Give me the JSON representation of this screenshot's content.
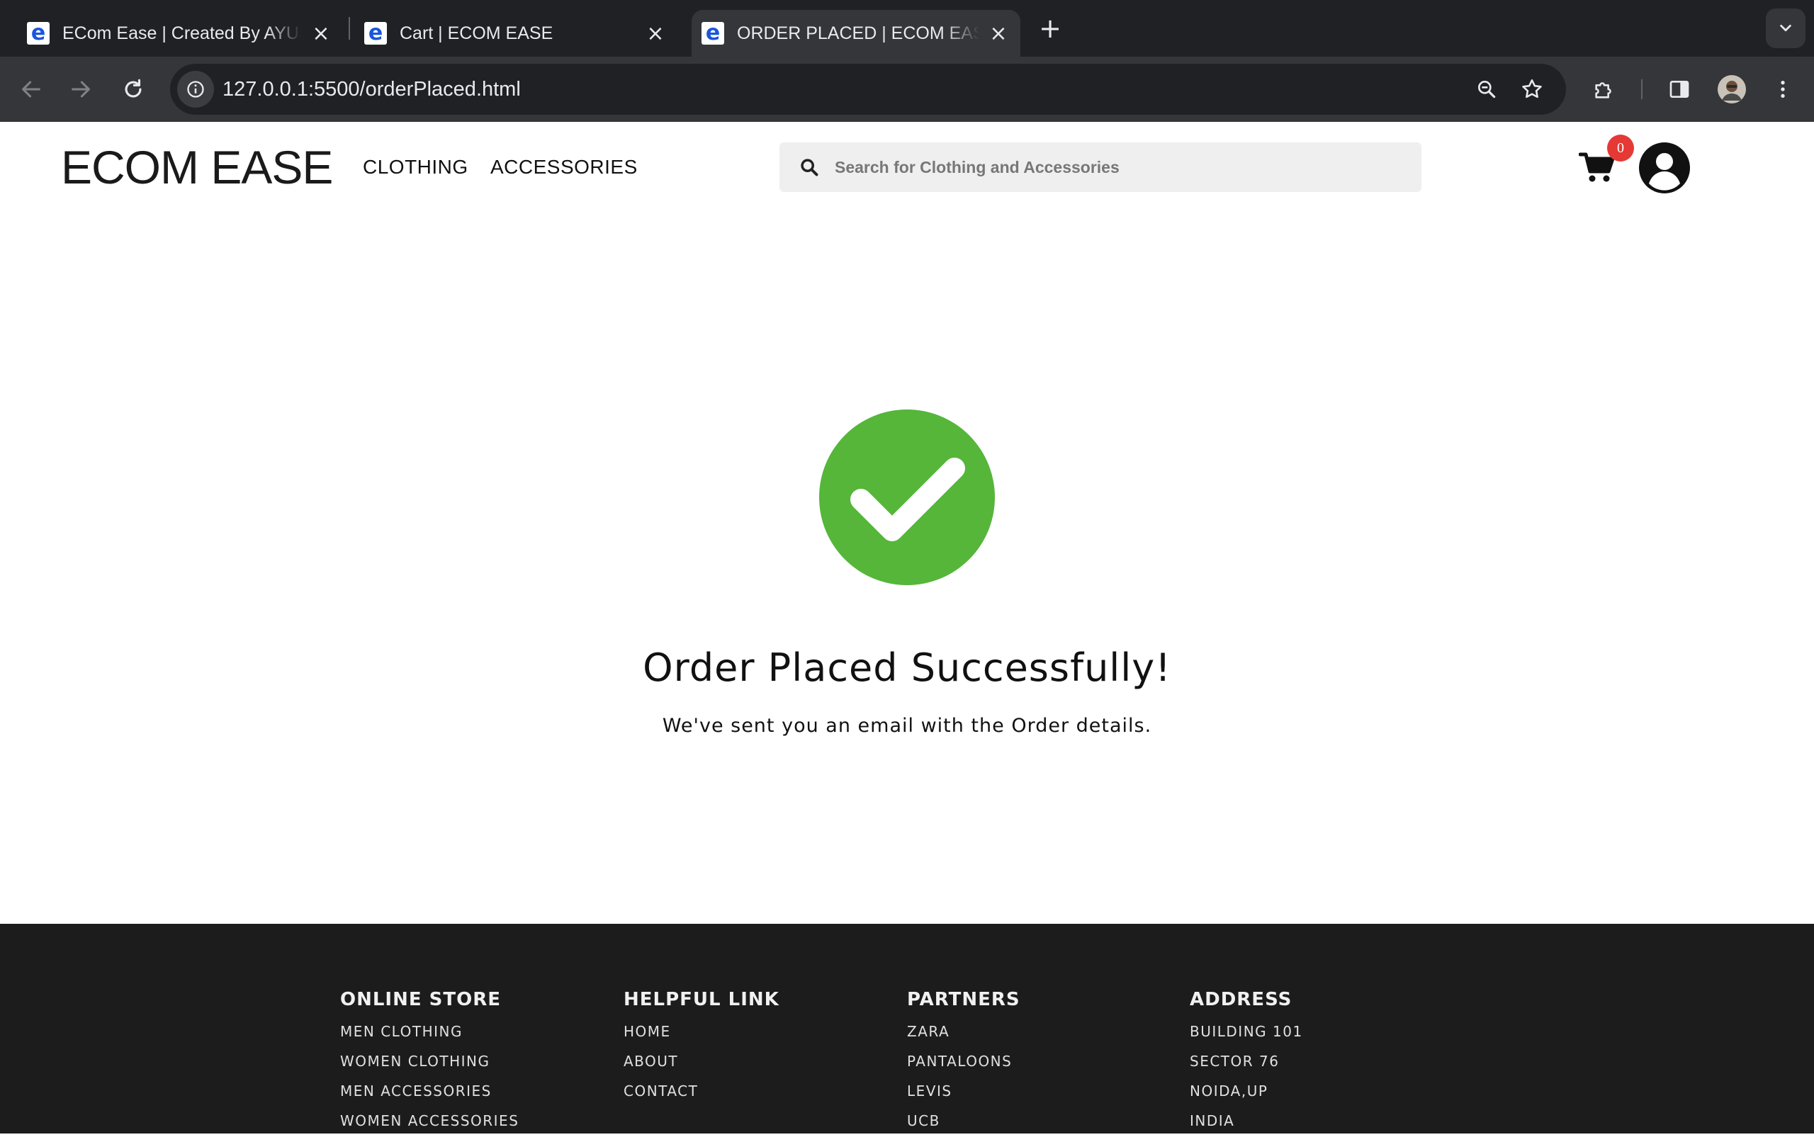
{
  "browser": {
    "tabs": [
      {
        "title": "ECom Ease | Created By AYUSH",
        "favicon": "e-logo-icon",
        "active": false
      },
      {
        "title": "Cart | ECOM EASE",
        "favicon": "e-logo-icon",
        "active": false
      },
      {
        "title": "ORDER PLACED | ECOM EASE",
        "favicon": "e-logo-icon",
        "active": true
      }
    ],
    "favicon_glyph": "e",
    "close_glyph": "×",
    "newtab_glyph": "+",
    "url": "127.0.0.1:5500/orderPlaced.html"
  },
  "header": {
    "logo": "ECOM EASE",
    "nav": [
      "CLOTHING",
      "ACCESSORIES"
    ],
    "search_placeholder": "Search for Clothing and Accessories",
    "cart_count": "0"
  },
  "confirmation": {
    "title": "Order Placed Successfully!",
    "subtitle": "We've sent you an email with the Order details.",
    "check_color": "#55b63a"
  },
  "footer": {
    "columns": [
      {
        "heading": "ONLINE STORE",
        "items": [
          "MEN CLOTHING",
          "WOMEN CLOTHING",
          "MEN ACCESSORIES",
          "WOMEN ACCESSORIES"
        ]
      },
      {
        "heading": "HELPFUL LINK",
        "items": [
          "HOME",
          "ABOUT",
          "CONTACT"
        ]
      },
      {
        "heading": "PARTNERS",
        "items": [
          "ZARA",
          "PANTALOONS",
          "LEVIS",
          "UCB"
        ]
      },
      {
        "heading": "ADDRESS",
        "items": [
          "BUILDING 101",
          "SECTOR 76",
          "NOIDA,UP",
          "INDIA"
        ]
      }
    ]
  },
  "colors": {
    "chrome_dark": "#202124",
    "chrome_toolbar": "#35363a",
    "badge": "#e53935",
    "footer_bg": "#1c1c1c"
  }
}
